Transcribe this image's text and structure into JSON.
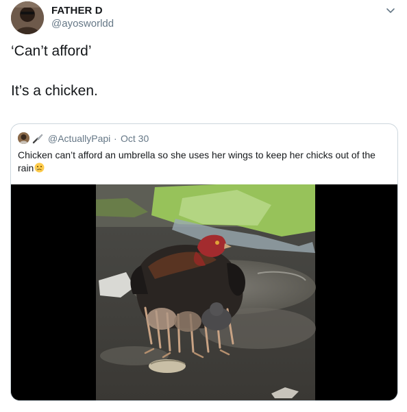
{
  "tweet": {
    "author_name": "FATHER D",
    "author_handle": "@ayosworldd",
    "text_line1": "‘Can’t afford’",
    "text_line2": "It’s a chicken."
  },
  "quoted_tweet": {
    "handle": "@ActuallyPapi",
    "separator": "·",
    "date": "Oct 30",
    "text": "Chicken can’t afford an umbrella so she uses her wings to keep her chicks out of the rain",
    "emoji": "sad-face-emoji"
  },
  "icons": {
    "menu": "chevron-down-icon",
    "name_decoration": "knife-icon"
  },
  "colors": {
    "primary_text": "#14171a",
    "secondary_text": "#657786",
    "border": "#ccd6dd",
    "media_background": "#000000"
  }
}
